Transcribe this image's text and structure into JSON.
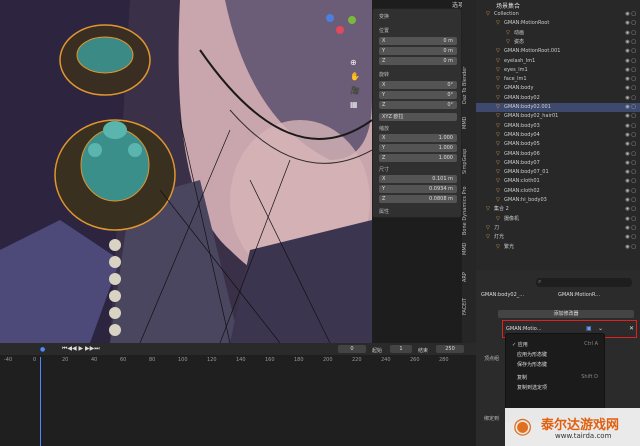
{
  "header": {
    "top_label": "选项"
  },
  "npanel": {
    "section_transform": "变换",
    "location": "位置",
    "rotation": "旋转",
    "scale": "缩放",
    "dimensions": "尺寸",
    "properties": "属性",
    "loc": [
      {
        "axis": "X",
        "value": "0 m"
      },
      {
        "axis": "Y",
        "value": "0 m"
      },
      {
        "axis": "Z",
        "value": "0 m"
      }
    ],
    "rot": [
      {
        "axis": "X",
        "value": "0°"
      },
      {
        "axis": "Y",
        "value": "0°"
      },
      {
        "axis": "Z",
        "value": "0°"
      }
    ],
    "rot_mode": "XYZ 欧拉",
    "scl": [
      {
        "axis": "X",
        "value": "1.000"
      },
      {
        "axis": "Y",
        "value": "1.000"
      },
      {
        "axis": "Z",
        "value": "1.000"
      }
    ],
    "dim": [
      {
        "axis": "X",
        "value": "0.101 m"
      },
      {
        "axis": "Y",
        "value": "0.0934 m"
      },
      {
        "axis": "Z",
        "value": "0.0808 m"
      }
    ]
  },
  "ntabs": [
    "Daz To Blender",
    "MMD",
    "SimpGesp",
    "Bone Dynamics Pro",
    "Bone Dynamics Pro",
    "MMD",
    "ARP",
    "FACEIT"
  ],
  "outliner": {
    "title": "场景集合",
    "rows": [
      {
        "label": "Collection",
        "indent": 0
      },
      {
        "label": "GMAN:MotionRoot",
        "indent": 1
      },
      {
        "label": "动画",
        "indent": 2
      },
      {
        "label": "姿态",
        "indent": 2
      },
      {
        "label": "GMAN:MotionRoot.001",
        "indent": 1
      },
      {
        "label": "eyelash_lm1",
        "indent": 1
      },
      {
        "label": "eyes_lm1",
        "indent": 1
      },
      {
        "label": "face_lm1",
        "indent": 1
      },
      {
        "label": "GMAN:body",
        "indent": 1
      },
      {
        "label": "GMAN:body02",
        "indent": 1
      },
      {
        "label": "GMAN:body02.001",
        "indent": 1
      },
      {
        "label": "GMAN:body02_hair01",
        "indent": 1
      },
      {
        "label": "GMAN:body03",
        "indent": 1
      },
      {
        "label": "GMAN:body04",
        "indent": 1
      },
      {
        "label": "GMAN:body05",
        "indent": 1
      },
      {
        "label": "GMAN:body06",
        "indent": 1
      },
      {
        "label": "GMAN:body07",
        "indent": 1
      },
      {
        "label": "GMAN:body07_01",
        "indent": 1
      },
      {
        "label": "GMAN:cloth01",
        "indent": 1
      },
      {
        "label": "GMAN:cloth02",
        "indent": 1
      },
      {
        "label": "GMAN:hi_body03",
        "indent": 1
      },
      {
        "label": "集合 2",
        "indent": 0
      },
      {
        "label": "摄像机",
        "indent": 1
      },
      {
        "label": "刀",
        "indent": 0
      },
      {
        "label": "灯光",
        "indent": 0
      },
      {
        "label": "繁光",
        "indent": 1
      }
    ],
    "selected_index": 10
  },
  "props": {
    "search_placeholder": "",
    "obj_name": "GMAN:body02_...",
    "mod_target": "GMAN:MotionR...",
    "add_modifier": "添加修改器",
    "mod_name": "GMAN:Motio...",
    "vertex_group": "顶点组",
    "bind_to": "绑定到"
  },
  "menu": {
    "items": [
      {
        "label": "应用",
        "key": "Ctrl A"
      },
      {
        "label": "应用为形态键",
        "key": ""
      },
      {
        "label": "保存为形态键",
        "key": ""
      },
      {
        "label": "复制",
        "key": "Shift D"
      },
      {
        "label": "复制到选定项",
        "key": ""
      }
    ]
  },
  "timeline": {
    "frame": "0",
    "start_label": "起始",
    "start": "1",
    "end_label": "结束",
    "end": "250",
    "ticks": [
      "-40",
      "0",
      "20",
      "40",
      "60",
      "80",
      "100",
      "120",
      "140",
      "160",
      "180",
      "200",
      "220",
      "240",
      "260",
      "280"
    ]
  },
  "watermark": {
    "name": "泰尔达游戏网",
    "url": "www.tairda.com"
  }
}
